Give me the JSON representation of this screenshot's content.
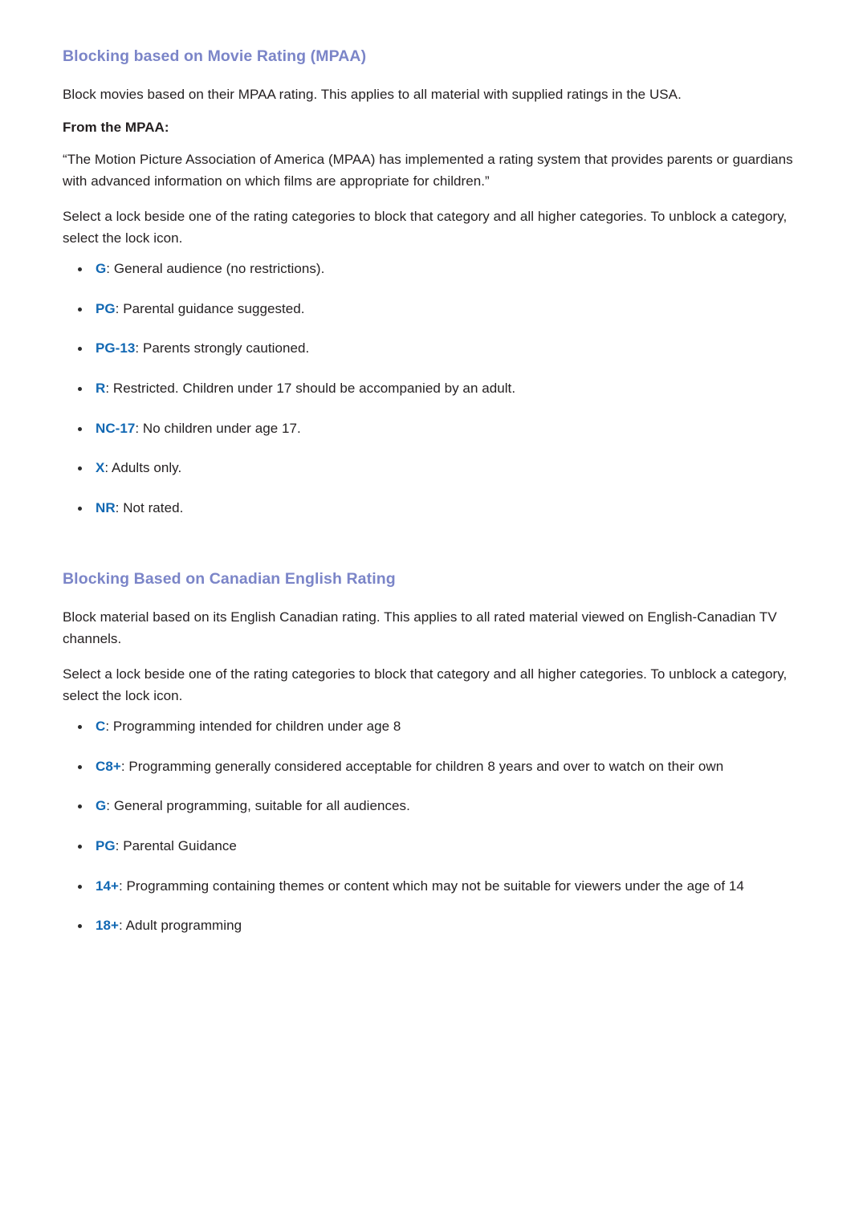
{
  "colors": {
    "heading": "#7b85c8",
    "rating_code": "#1268b3",
    "body_text": "#231f20",
    "background": "#ffffff",
    "bullet": "#2b2b2b"
  },
  "sections": [
    {
      "heading": "Blocking based on Movie Rating (MPAA)",
      "intro": "Block movies based on their MPAA rating. This applies to all material with supplied ratings in the USA.",
      "subheading": "From the MPAA:",
      "quote": "“The Motion Picture Association of America (MPAA) has implemented a rating system that provides parents or guardians with advanced information on which films are appropriate for children.”",
      "instruction": "Select a lock beside one of the rating categories to block that category and all higher categories. To unblock a category, select the lock icon.",
      "ratings": [
        {
          "code": "G",
          "separator": ": ",
          "description": "General audience (no restrictions)."
        },
        {
          "code": "PG",
          "separator": ": ",
          "description": "Parental guidance suggested."
        },
        {
          "code": "PG-13",
          "separator": ": ",
          "description": "Parents strongly cautioned."
        },
        {
          "code": "R",
          "separator": ": ",
          "description": "Restricted. Children under 17 should be accompanied by an adult."
        },
        {
          "code": "NC-17",
          "separator": ": ",
          "description": "No children under age 17."
        },
        {
          "code": "X",
          "separator": ": ",
          "description": "Adults only."
        },
        {
          "code": "NR",
          "separator": ": ",
          "description": "Not rated."
        }
      ]
    },
    {
      "heading": "Blocking Based on Canadian English Rating",
      "intro": "Block material based on its English Canadian rating. This applies to all rated material viewed on English-Canadian TV channels.",
      "instruction": "Select a lock beside one of the rating categories to block that category and all higher categories. To unblock a category, select the lock icon.",
      "ratings": [
        {
          "code": "C",
          "separator": ": ",
          "description": "Programming intended for children under age 8"
        },
        {
          "code": "C8+",
          "separator": ": ",
          "description": "Programming generally considered acceptable for children 8 years and over to watch on their own"
        },
        {
          "code": "G",
          "separator": ": ",
          "description": "General programming, suitable for all audiences."
        },
        {
          "code": "PG",
          "separator": ": ",
          "description": "Parental Guidance"
        },
        {
          "code": "14+",
          "separator": ": ",
          "description": "Programming containing themes or content which may not be suitable for viewers under the age of 14"
        },
        {
          "code": "18+",
          "separator": ": ",
          "description": "Adult programming"
        }
      ]
    }
  ]
}
